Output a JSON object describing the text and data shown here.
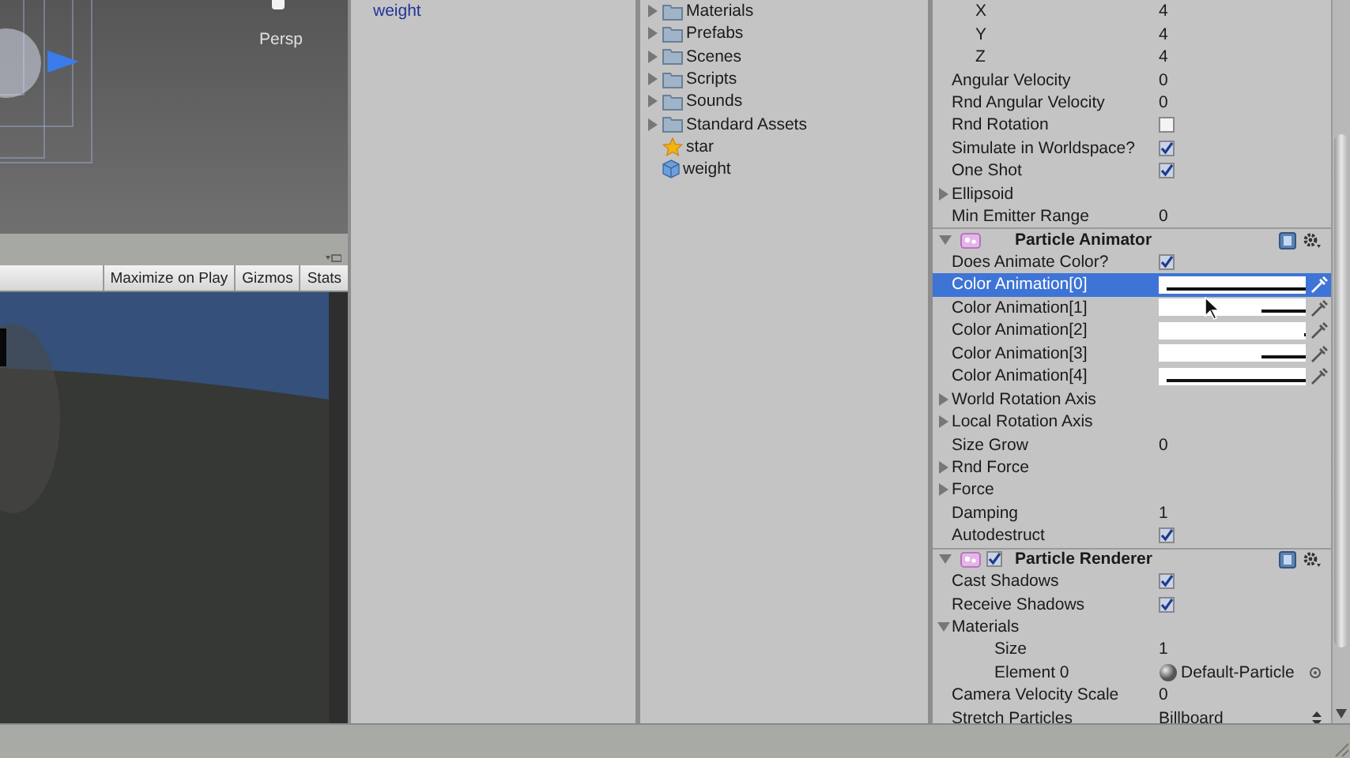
{
  "scene_view": {
    "camera_label": "Persp"
  },
  "game_view": {
    "toolbar": [
      "Maximize on Play",
      "Gizmos",
      "Stats"
    ]
  },
  "hierarchy": {
    "items": [
      {
        "label": "weight"
      }
    ]
  },
  "project": {
    "items": [
      {
        "label": "Materials",
        "kind": "folder"
      },
      {
        "label": "Prefabs",
        "kind": "folder"
      },
      {
        "label": "Scenes",
        "kind": "folder"
      },
      {
        "label": "Scripts",
        "kind": "folder"
      },
      {
        "label": "Sounds",
        "kind": "folder"
      },
      {
        "label": "Standard Assets",
        "kind": "folder"
      },
      {
        "label": "star",
        "kind": "prefab"
      },
      {
        "label": "weight",
        "kind": "mesh"
      }
    ]
  },
  "inspector": {
    "rows": [
      {
        "kind": "nested",
        "children": [
          {
            "kind": "field",
            "label": "X",
            "value": "4"
          },
          {
            "kind": "field",
            "label": "Y",
            "value": "4"
          },
          {
            "kind": "field",
            "label": "Z",
            "value": "4"
          }
        ]
      },
      {
        "kind": "field",
        "label": "Angular Velocity",
        "value": "0"
      },
      {
        "kind": "field",
        "label": "Rnd Angular Velocity",
        "value": "0"
      },
      {
        "kind": "checkbox",
        "label": "Rnd Rotation",
        "checked": false
      },
      {
        "kind": "checkbox",
        "label": "Simulate in Worldspace?",
        "checked": true
      },
      {
        "kind": "checkbox",
        "label": "One Shot",
        "checked": true
      },
      {
        "kind": "foldout",
        "label": "Ellipsoid",
        "expanded": false
      },
      {
        "kind": "field",
        "label": "Min Emitter Range",
        "value": "0"
      },
      {
        "kind": "component",
        "title": "Particle Animator",
        "expanded": true
      },
      {
        "kind": "checkbox",
        "label": "Does Animate Color?",
        "checked": true
      },
      {
        "kind": "color",
        "label": "Color Animation[0]",
        "selected": true,
        "level": 0.95
      },
      {
        "kind": "color",
        "label": "Color Animation[1]",
        "selected": false,
        "level": 0.3
      },
      {
        "kind": "color",
        "label": "Color Animation[2]",
        "selected": false,
        "level": 0
      },
      {
        "kind": "color",
        "label": "Color Animation[3]",
        "selected": false,
        "level": 0.3
      },
      {
        "kind": "color",
        "label": "Color Animation[4]",
        "selected": false,
        "level": 0.95
      },
      {
        "kind": "foldout",
        "label": "World Rotation Axis",
        "expanded": false
      },
      {
        "kind": "foldout",
        "label": "Local Rotation Axis",
        "expanded": false
      },
      {
        "kind": "field",
        "label": "Size Grow",
        "value": "0"
      },
      {
        "kind": "foldout",
        "label": "Rnd Force",
        "expanded": false
      },
      {
        "kind": "foldout",
        "label": "Force",
        "expanded": false
      },
      {
        "kind": "field",
        "label": "Damping",
        "value": "1"
      },
      {
        "kind": "checkbox",
        "label": "Autodestruct",
        "checked": true
      },
      {
        "kind": "component",
        "title": "Particle Renderer",
        "expanded": true,
        "enabled": true
      },
      {
        "kind": "checkbox",
        "label": "Cast Shadows",
        "checked": true
      },
      {
        "kind": "checkbox",
        "label": "Receive Shadows",
        "checked": true
      },
      {
        "kind": "foldout",
        "label": "Materials",
        "expanded": true,
        "children": [
          {
            "kind": "field",
            "label": "Size",
            "value": "1"
          },
          {
            "kind": "object",
            "label": "Element 0",
            "value": "Default-Particle"
          }
        ]
      },
      {
        "kind": "field",
        "label": "Camera Velocity Scale",
        "value": "0"
      },
      {
        "kind": "dropdown",
        "label": "Stretch Particles",
        "value": "Billboard"
      }
    ]
  }
}
